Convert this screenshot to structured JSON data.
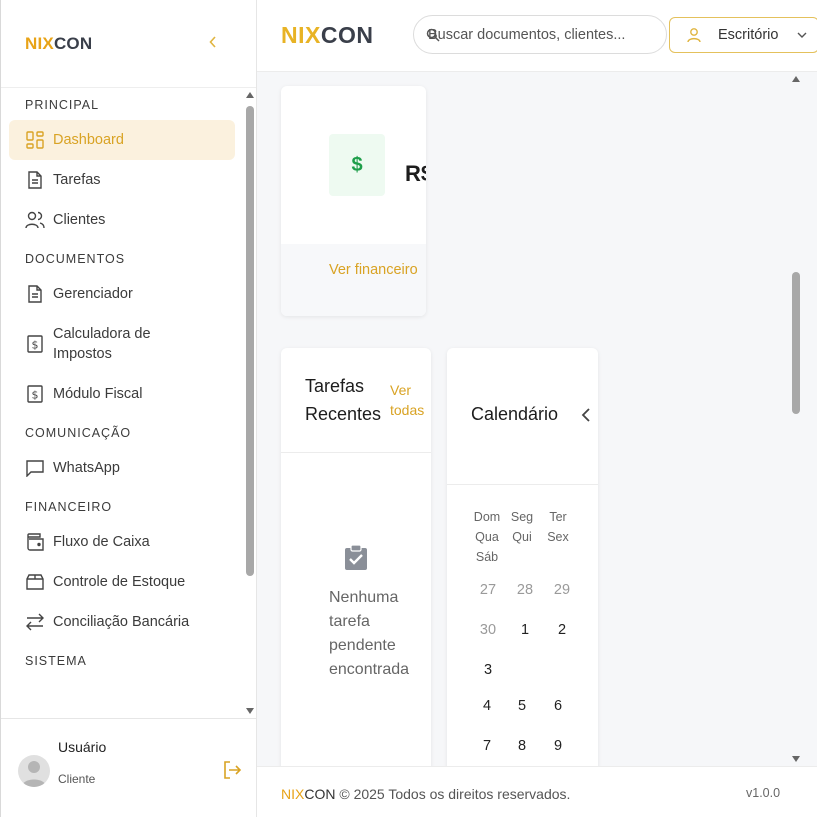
{
  "brand": {
    "part1": "NIX",
    "part2": "CON"
  },
  "sidebar": {
    "sections": [
      {
        "title": "PRINCIPAL",
        "items": [
          {
            "label": "Dashboard",
            "icon": "dashboard-grid-icon",
            "active": true
          },
          {
            "label": "Tarefas",
            "icon": "document-icon"
          },
          {
            "label": "Clientes",
            "icon": "users-icon"
          }
        ]
      },
      {
        "title": "DOCUMENTOS",
        "items": [
          {
            "label": "Gerenciador",
            "icon": "document-icon"
          },
          {
            "label": "Calculadora de Impostos",
            "icon": "dollar-box-icon"
          },
          {
            "label": "Módulo Fiscal",
            "icon": "dollar-box-icon"
          }
        ]
      },
      {
        "title": "COMUNICAÇÃO",
        "items": [
          {
            "label": "WhatsApp",
            "icon": "chat-icon"
          }
        ]
      },
      {
        "title": "FINANCEIRO",
        "items": [
          {
            "label": "Fluxo de Caixa",
            "icon": "wallet-icon"
          },
          {
            "label": "Controle de Estoque",
            "icon": "box-icon"
          },
          {
            "label": "Conciliação Bancária",
            "icon": "swap-arrows-icon"
          }
        ]
      },
      {
        "title": "SISTEMA",
        "items": []
      }
    ],
    "user": {
      "name": "Usuário",
      "role": "Cliente"
    }
  },
  "header": {
    "search_placeholder": "Buscar documentos, clientes...",
    "office_label": "Escritório"
  },
  "main": {
    "finance_card": {
      "value": "R$",
      "link": "Ver financeiro"
    },
    "tasks_card": {
      "title": "Tarefas Recentes",
      "view_all": "Ver todas",
      "empty": "Nenhuma tarefa pendente encontrada"
    },
    "calendar": {
      "title": "Calendário",
      "weekdays": [
        "Dom",
        "Seg",
        "Ter",
        "Qua",
        "Qui",
        "Sex",
        "Sáb"
      ],
      "days": [
        "27",
        "28",
        "29",
        "30",
        "1",
        "2",
        "3",
        "4",
        "5",
        "6",
        "7",
        "8",
        "9"
      ]
    }
  },
  "footer": {
    "text": "© 2025 Todos os direitos reservados.",
    "version": "v1.0.0"
  },
  "colors": {
    "accent": "#e8a317",
    "active_bg": "#fbf1de",
    "money_green": "#1e9e4a"
  }
}
